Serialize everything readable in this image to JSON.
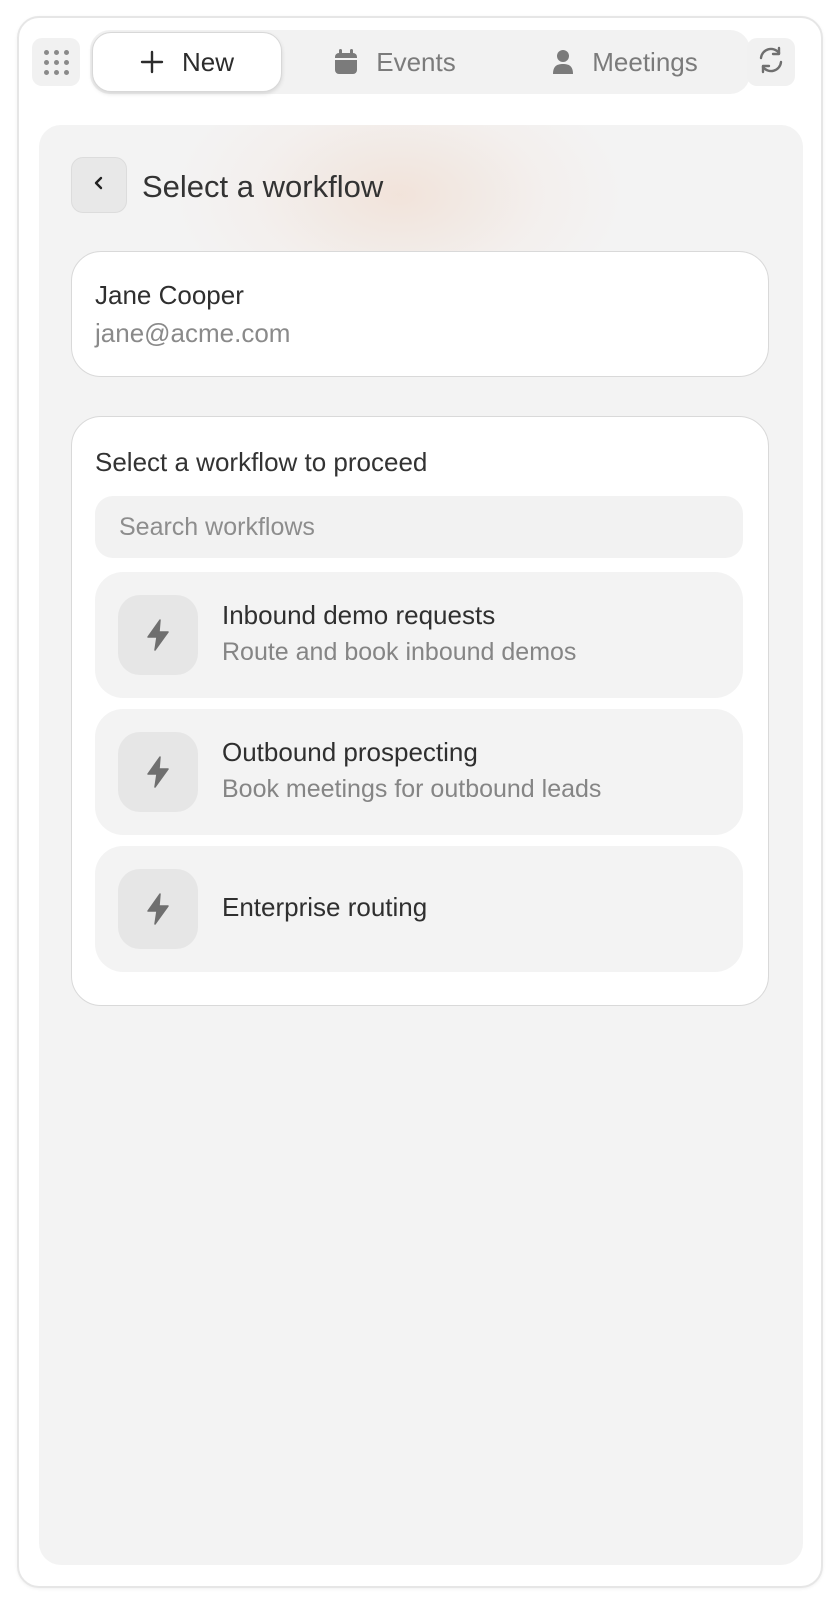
{
  "tabs": [
    {
      "label": "New",
      "icon": "plus-icon",
      "active": true
    },
    {
      "label": "Events",
      "icon": "calendar-icon",
      "active": false
    },
    {
      "label": "Meetings",
      "icon": "person-icon",
      "active": false
    }
  ],
  "toolbar": {
    "apps_icon": "grid-dots-icon",
    "refresh_icon": "refresh-icon"
  },
  "panel": {
    "title": "Select a workflow",
    "back_icon": "chevron-left-icon"
  },
  "contact": {
    "name": "Jane Cooper",
    "email": "jane@acme.com"
  },
  "workflows": {
    "heading": "Select a workflow to proceed",
    "search_placeholder": "Search workflows",
    "search_value": "",
    "items": [
      {
        "title": "Inbound demo requests",
        "description": "Route and book inbound demos",
        "icon": "lightning-icon"
      },
      {
        "title": "Outbound prospecting",
        "description": "Book meetings for outbound leads",
        "icon": "lightning-icon"
      },
      {
        "title": "Enterprise routing",
        "description": "",
        "icon": "lightning-icon"
      }
    ]
  },
  "colors": {
    "panel_bg": "#f3f3f3",
    "card_bg": "#ffffff",
    "muted_text": "#858585",
    "icon_gray": "#6f6f6f",
    "accent_glow": "#f0d6c6"
  }
}
